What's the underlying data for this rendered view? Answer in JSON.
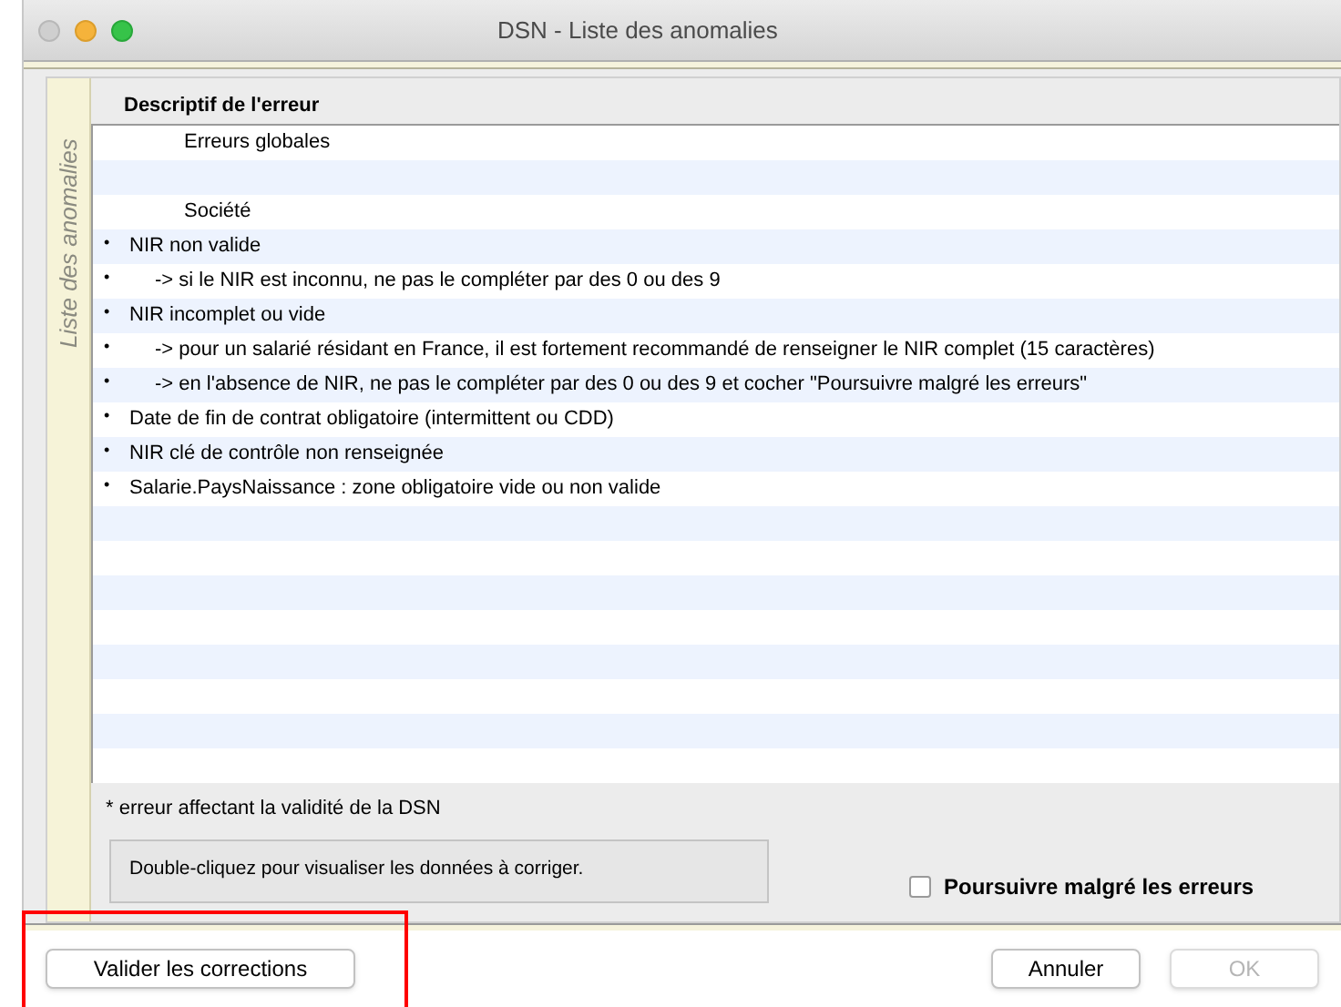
{
  "window": {
    "title": "DSN - Liste des anomalies"
  },
  "side_tab": {
    "label": "Liste des anomalies"
  },
  "table": {
    "columns": [
      "Descriptif de l'erreur"
    ],
    "rows": [
      {
        "kind": "group",
        "text": "Erreurs globales"
      },
      {
        "kind": "blank"
      },
      {
        "kind": "group",
        "text": "Société"
      },
      {
        "kind": "error",
        "bullet": "•",
        "text": "NIR non valide"
      },
      {
        "kind": "detail",
        "bullet": "•",
        "text": "-> si le NIR est inconnu, ne pas le compléter par des 0 ou des 9"
      },
      {
        "kind": "error",
        "bullet": "•",
        "text": "NIR incomplet ou vide"
      },
      {
        "kind": "detail",
        "bullet": "•",
        "text": "-> pour un salarié résidant en France, il est fortement recommandé de renseigner le NIR complet (15 caractères)"
      },
      {
        "kind": "detail",
        "bullet": "•",
        "text": "-> en l'absence de NIR, ne pas le compléter par des 0 ou des 9 et cocher \"Poursuivre malgré les erreurs\""
      },
      {
        "kind": "error",
        "bullet": "•",
        "text": "Date de fin de contrat obligatoire (intermittent ou CDD)"
      },
      {
        "kind": "error",
        "bullet": "•",
        "text": "NIR clé de contrôle non renseignée"
      },
      {
        "kind": "error",
        "bullet": "•",
        "text": "Salarie.PaysNaissance : zone obligatoire vide ou non valide"
      }
    ]
  },
  "footnote": "* erreur affectant la validité de la DSN",
  "hint": "Double-cliquez pour visualiser les données à corriger.",
  "continue_checkbox": {
    "label": "Poursuivre malgré les erreurs",
    "checked": false
  },
  "buttons": [
    {
      "label": "Valider les corrections",
      "disabled": false,
      "highlighted": true
    },
    {
      "label": "Annuler",
      "disabled": false,
      "highlighted": false
    },
    {
      "label": "OK",
      "disabled": true,
      "highlighted": false
    }
  ]
}
